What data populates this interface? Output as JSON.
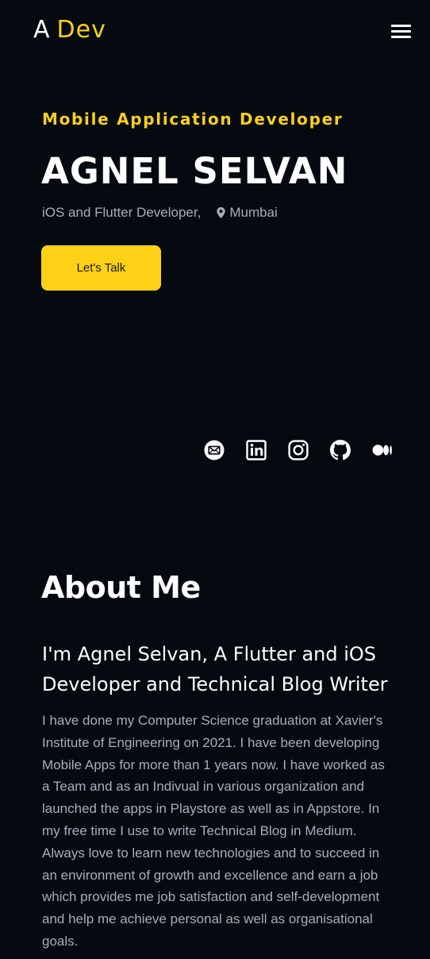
{
  "header": {
    "logo_mark": "A",
    "logo_text": "Dev"
  },
  "hero": {
    "role": "Mobile Application Developer",
    "name": "AGNEL SELVAN",
    "subtitle": "iOS and Flutter Developer,",
    "location": "Mumbai",
    "cta_label": "Let's Talk"
  },
  "socials": [
    "mail-icon",
    "linkedin-icon",
    "instagram-icon",
    "github-icon",
    "medium-icon"
  ],
  "about": {
    "title": "About Me",
    "heading": "I'm Agnel Selvan, A Flutter and iOS Developer and Technical Blog Writer",
    "body": "I have done my Computer Science graduation at Xavier's Institute of Engineering on 2021. I have been developing Mobile Apps for more than 1 years now. I have worked as a Team and as an Indivual in various organization and launched the apps in Playstore as well as in Appstore. In my free time I use to write Technical Blog in Medium. Always love to learn new technologies and to succeed in an environment of growth and excellence and earn a job which provides me job satisfaction and self-development and help me achieve personal as well as organisational goals."
  },
  "colors": {
    "background": "#050a11",
    "accent": "#fcd116",
    "muted_text": "#a8aeb6"
  }
}
